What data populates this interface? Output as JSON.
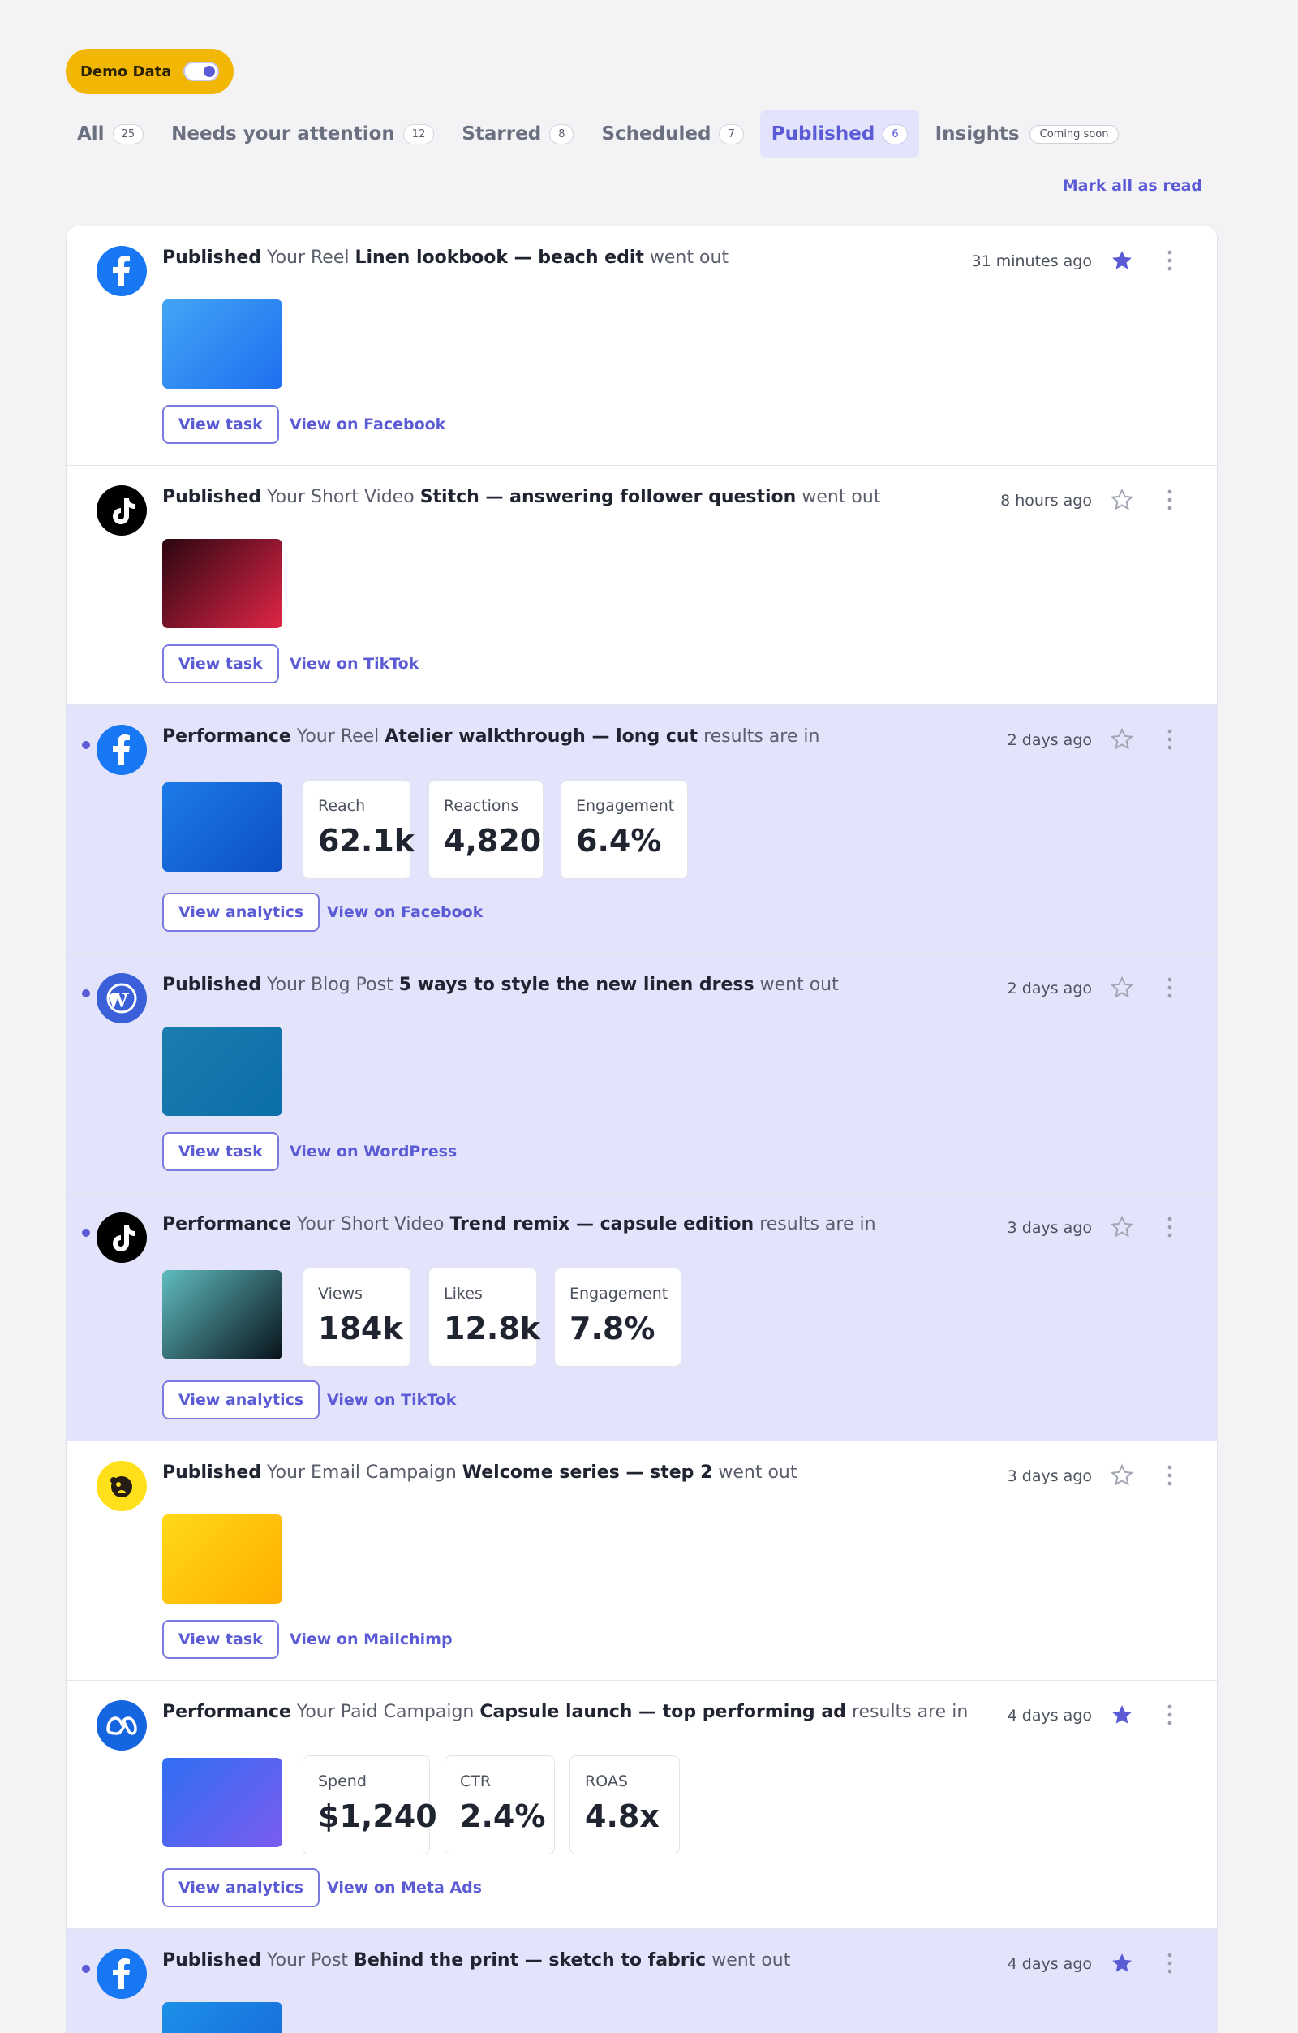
{
  "demo": {
    "label": "Demo Data",
    "enabled": true
  },
  "tabs": [
    {
      "label": "All",
      "count": "25"
    },
    {
      "label": "Needs your attention",
      "count": "12"
    },
    {
      "label": "Starred",
      "count": "8"
    },
    {
      "label": "Scheduled",
      "count": "7"
    },
    {
      "label": "Published",
      "count": "6",
      "active": true
    },
    {
      "label": "Insights",
      "badge": "Coming soon"
    }
  ],
  "mark_all_read": "Mark all as read",
  "items": [
    {
      "platform": "facebook",
      "kind": "Published",
      "subject": "Your Reel",
      "title": "Linen lookbook — beach edit",
      "suffix": "went out",
      "time": "31 minutes ago",
      "starred": true,
      "unread": false,
      "primary_action": "View task",
      "secondary_action": "View on Facebook"
    },
    {
      "platform": "tiktok",
      "kind": "Published",
      "subject": "Your Short Video",
      "title": "Stitch — answering follower question",
      "suffix": "went out",
      "time": "8 hours ago",
      "starred": false,
      "unread": false,
      "primary_action": "View task",
      "secondary_action": "View on TikTok"
    },
    {
      "platform": "facebook",
      "kind": "Performance",
      "subject": "Your Reel",
      "title": "Atelier walkthrough — long cut",
      "suffix": "results are in",
      "time": "2 days ago",
      "starred": false,
      "unread": true,
      "metrics": [
        {
          "label": "Reach",
          "value": "62.1k"
        },
        {
          "label": "Reactions",
          "value": "4,820"
        },
        {
          "label": "Engagement",
          "value": "6.4%"
        }
      ],
      "primary_action": "View analytics",
      "secondary_action": "View on Facebook"
    },
    {
      "platform": "wordpress",
      "kind": "Published",
      "subject": "Your Blog Post",
      "title": "5 ways to style the new linen dress",
      "suffix": "went out",
      "time": "2 days ago",
      "starred": false,
      "unread": true,
      "primary_action": "View task",
      "secondary_action": "View on WordPress"
    },
    {
      "platform": "tiktok",
      "kind": "Performance",
      "subject": "Your Short Video",
      "title": "Trend remix — capsule edition",
      "suffix": "results are in",
      "time": "3 days ago",
      "starred": false,
      "unread": true,
      "metrics": [
        {
          "label": "Views",
          "value": "184k"
        },
        {
          "label": "Likes",
          "value": "12.8k"
        },
        {
          "label": "Engagement",
          "value": "7.8%"
        }
      ],
      "primary_action": "View analytics",
      "secondary_action": "View on TikTok"
    },
    {
      "platform": "mailchimp",
      "kind": "Published",
      "subject": "Your Email Campaign",
      "title": "Welcome series — step 2",
      "suffix": "went out",
      "time": "3 days ago",
      "starred": false,
      "unread": false,
      "primary_action": "View task",
      "secondary_action": "View on Mailchimp"
    },
    {
      "platform": "meta",
      "kind": "Performance",
      "subject": "Your Paid Campaign",
      "title": "Capsule launch — top performing ad",
      "suffix": "results are in",
      "time": "4 days ago",
      "starred": true,
      "unread": false,
      "metrics": [
        {
          "label": "Spend",
          "value": "$1,240"
        },
        {
          "label": "CTR",
          "value": "2.4%"
        },
        {
          "label": "ROAS",
          "value": "4.8x"
        }
      ],
      "primary_action": "View analytics",
      "secondary_action": "View on Meta Ads"
    },
    {
      "platform": "facebook",
      "kind": "Published",
      "subject": "Your Post",
      "title": "Behind the print — sketch to fabric",
      "suffix": "went out",
      "time": "4 days ago",
      "starred": true,
      "unread": true
    }
  ],
  "colors": {
    "accent": "#5b5bd6",
    "unread_bg": "#e3e3fb",
    "demo_pill": "#f2b705"
  }
}
